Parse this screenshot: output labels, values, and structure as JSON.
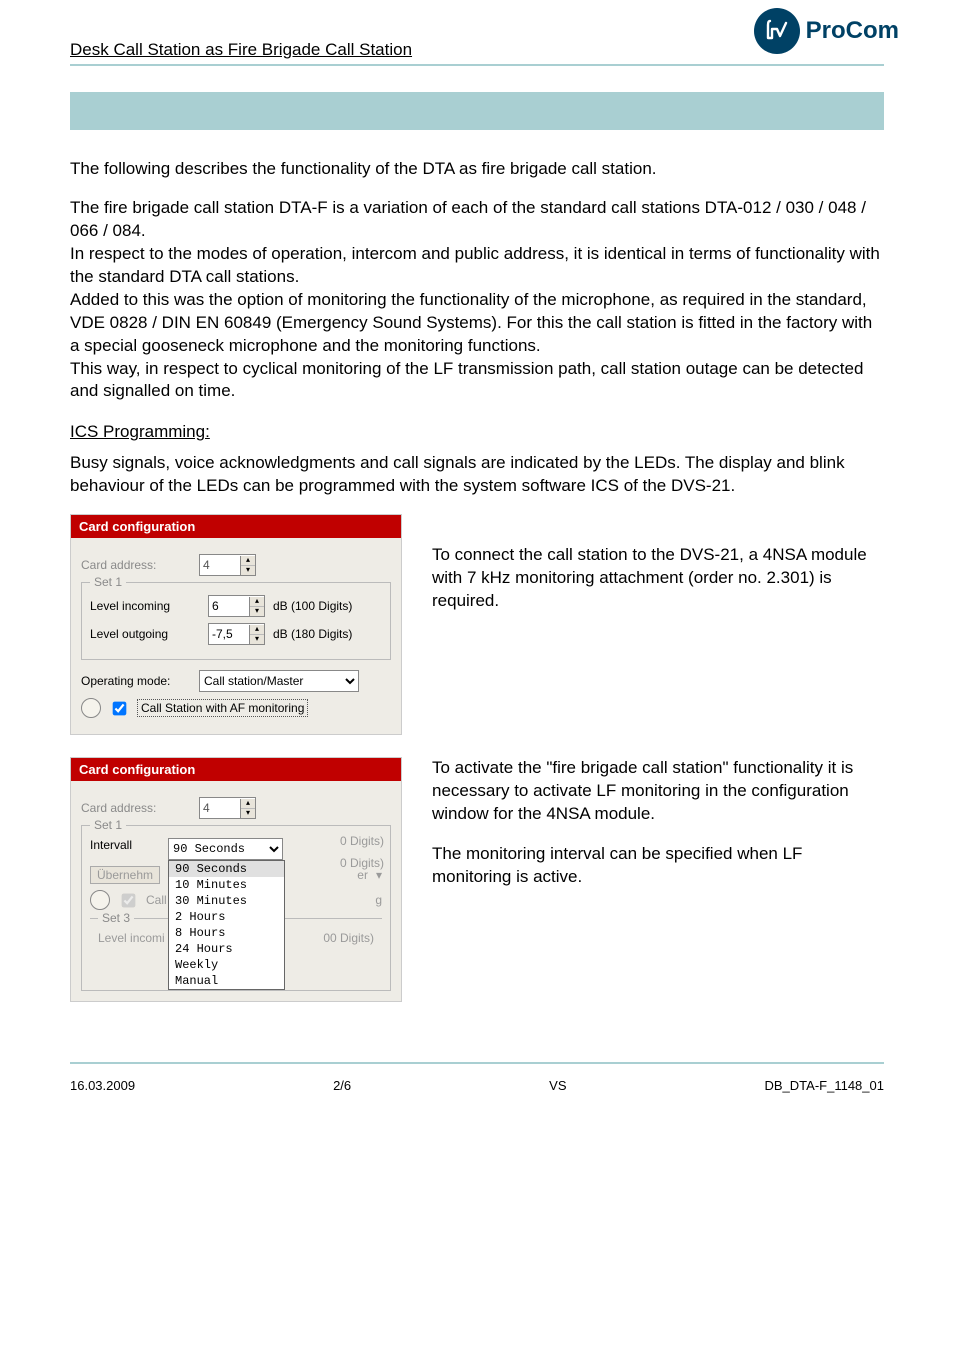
{
  "header": {
    "underline": "Desk Call Station as Fire Brigade Call Station"
  },
  "logo": {
    "text": "ProCom",
    "icon": "procom-logo"
  },
  "intro": {
    "p1": "The following describes the functionality of the DTA as fire brigade call station.",
    "p2": "The fire brigade call station DTA-F is a variation of each of the standard call stations DTA-012 / 030 / 048 / 066 / 084.",
    "p3": "In respect to the modes of operation, intercom and public address, it is identical in terms of functionality with the standard DTA call stations.",
    "p4": "Added to this was the option of monitoring the functionality of the microphone, as required in the standard, VDE 0828 / DIN EN 60849 (Emergency Sound Systems). For this the call station is fitted in the factory with a special gooseneck microphone and the monitoring functions.",
    "p5": "This way, in respect to cyclical monitoring of the LF transmission path, call station outage can be detected and signalled on time.",
    "h_ics": "ICS Programming:",
    "p6": "Busy signals, voice acknowledgments and call signals are indicated by the LEDs. The display and blink behaviour of the LEDs can be programmed with the system software ICS of the DVS-21."
  },
  "panel1": {
    "title": "Card configuration",
    "card_address_label": "Card address:",
    "card_address_value": "4",
    "set1_legend": "Set 1",
    "level_in_label": "Level incoming",
    "level_in_value": "6",
    "level_in_unit": "dB (100 Digits)",
    "level_out_label": "Level outgoing",
    "level_out_value": "-7,5",
    "level_out_unit": "dB (180 Digits)",
    "op_mode_label": "Operating mode:",
    "op_mode_value": "Call station/Master",
    "af_chk_label": "Call Station with AF monitoring"
  },
  "aside1": "To connect the call station to the DVS-21, a 4NSA module with 7 kHz monitoring attachment (order no. 2.301) is required.",
  "panel2": {
    "title": "Card configuration",
    "card_address_label": "Card address:",
    "card_address_value": "4",
    "set1_legend": "Set 1",
    "intervall_label": "Intervall",
    "intervall_value": "90 Seconds",
    "intervall_options": [
      "90 Seconds",
      "10 Minutes",
      "30 Minutes",
      "2 Hours",
      "8 Hours",
      "24 Hours",
      "Weekly",
      "Manual"
    ],
    "uebernehm": "Übernehm",
    "callst_chk": "Call St",
    "right_faded1": "0 Digits)",
    "right_faded2": "0 Digits)",
    "right_faded3": "er",
    "right_faded4": "g",
    "set3_legend": "Set 3",
    "level_incoming_faded": "Level incomi",
    "right_faded5": "00 Digits)"
  },
  "aside2a": "To activate the \"fire brigade call station\" functionality it is necessary to activate LF monitoring in the configuration window for the 4NSA module.",
  "aside2b": "The monitoring interval can be specified when LF monitoring is active.",
  "footer": {
    "date": "16.03.2009",
    "page": "2/6",
    "initials": "VS",
    "doc": "DB_DTA-F_1148_01"
  }
}
